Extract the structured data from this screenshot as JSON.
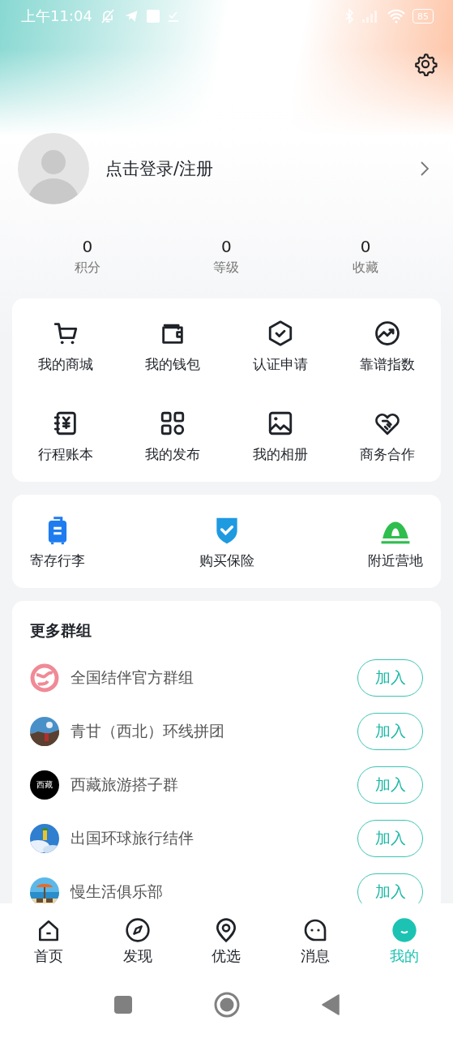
{
  "status_bar": {
    "time": "上午11:04",
    "battery": "85"
  },
  "profile": {
    "login_text": "点击登录/注册"
  },
  "stats": [
    {
      "value": "0",
      "label": "积分"
    },
    {
      "value": "0",
      "label": "等级"
    },
    {
      "value": "0",
      "label": "收藏"
    }
  ],
  "features": [
    {
      "label": "我的商城"
    },
    {
      "label": "我的钱包"
    },
    {
      "label": "认证申请"
    },
    {
      "label": "靠谱指数"
    },
    {
      "label": "行程账本"
    },
    {
      "label": "我的发布"
    },
    {
      "label": "我的相册"
    },
    {
      "label": "商务合作"
    }
  ],
  "services": [
    {
      "label": "寄存行李"
    },
    {
      "label": "购买保险"
    },
    {
      "label": "附近营地"
    }
  ],
  "groups": {
    "title": "更多群组",
    "items": [
      {
        "name": "全国结伴官方群组",
        "kind": "logo",
        "button": "加入"
      },
      {
        "name": "青甘（西北）环线拼团",
        "kind": "picture",
        "button": "加入"
      },
      {
        "name": "西藏旅游搭子群",
        "kind": "text",
        "avatar_text": "西藏",
        "button": "加入"
      },
      {
        "name": "出国环球旅行结伴",
        "kind": "picture",
        "button": "加入"
      },
      {
        "name": "慢生活俱乐部",
        "kind": "picture",
        "button": "加入"
      }
    ]
  },
  "tab_bar": [
    {
      "label": "首页",
      "selected": false
    },
    {
      "label": "发现",
      "selected": false
    },
    {
      "label": "优选",
      "selected": false
    },
    {
      "label": "消息",
      "selected": false
    },
    {
      "label": "我的",
      "selected": true
    }
  ]
}
